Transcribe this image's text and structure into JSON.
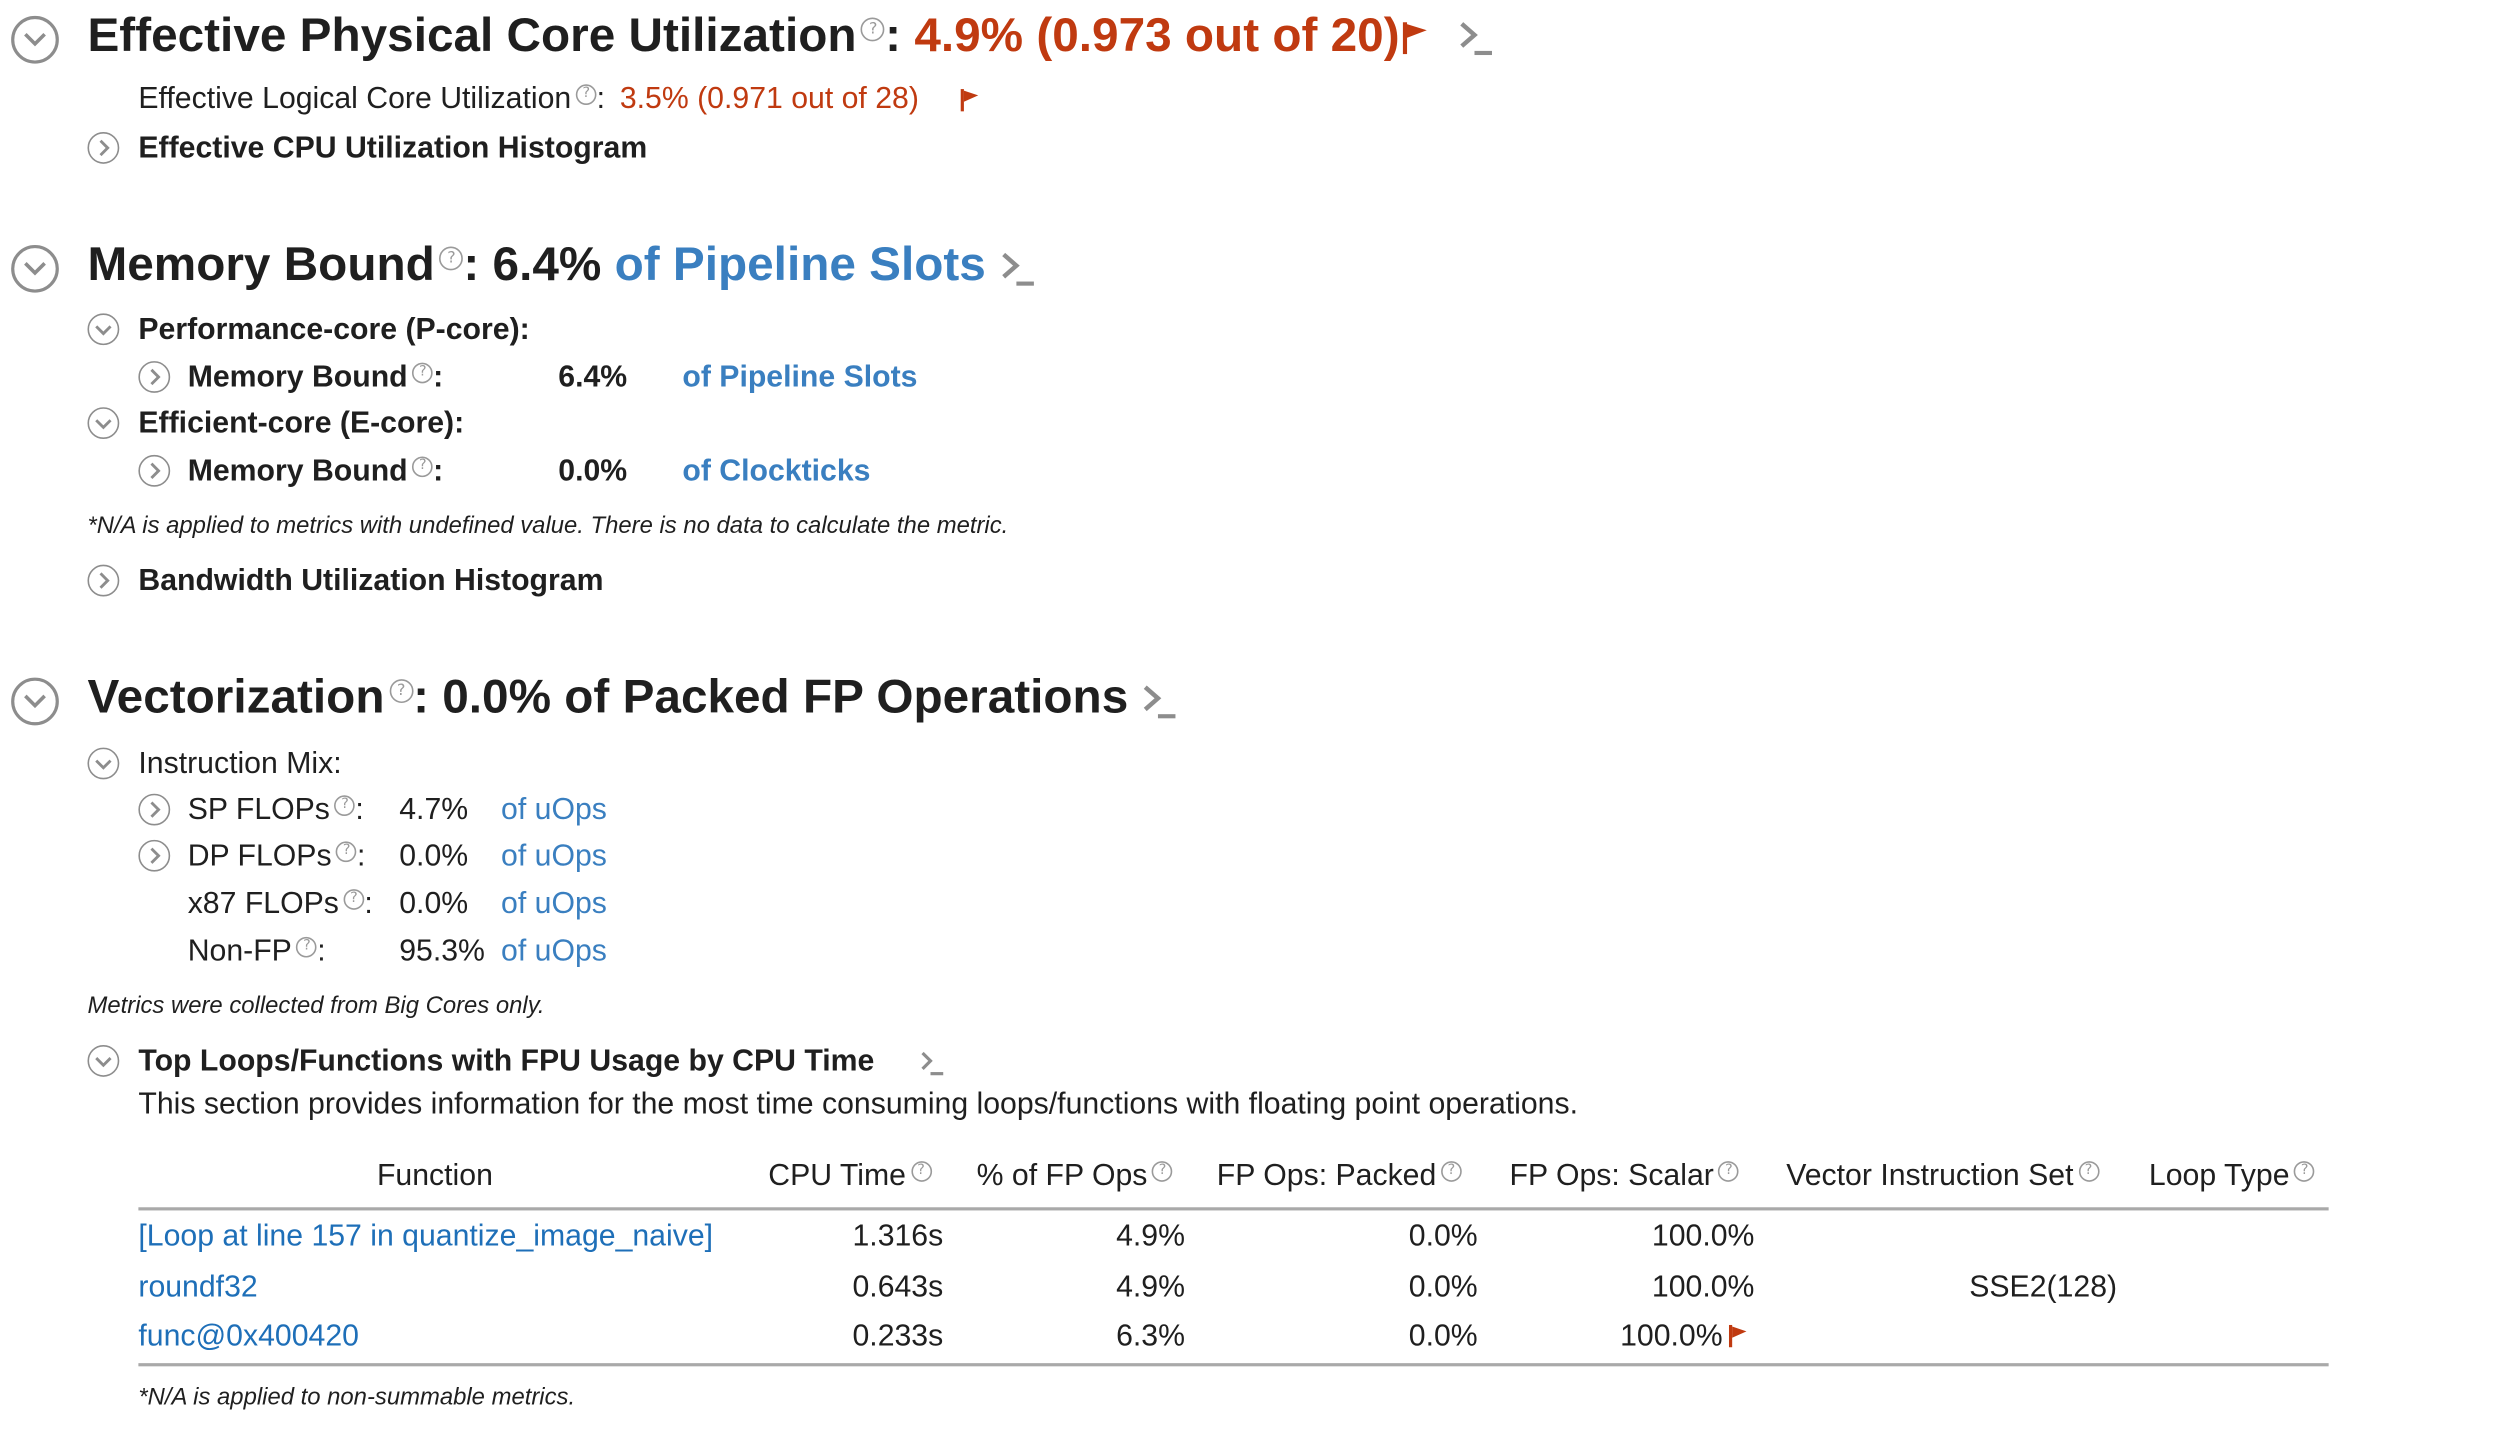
{
  "sections": {
    "physical": {
      "title": "Effective Physical Core Utilization",
      "colon": ":",
      "value": "4.9% (0.973 out of 20)",
      "logical_label": "Effective Logical Core Utilization",
      "logical_value": "3.5% (0.971 out of 28)",
      "histogram": "Effective CPU Utilization Histogram"
    },
    "memory": {
      "title": "Memory Bound",
      "value": ": 6.4%",
      "unit": "of Pipeline Slots",
      "pcore": "Performance-core (P-core):",
      "ecore": "Efficient-core (E-core):",
      "mb_label": "Memory Bound",
      "p_value": "6.4%",
      "p_unit": "of Pipeline Slots",
      "e_value": "0.0%",
      "e_unit": "of Clockticks",
      "na_note": "*N/A is applied to metrics with undefined value. There is no data to calculate the metric.",
      "bandwidth": "Bandwidth Utilization Histogram"
    },
    "vector": {
      "title": "Vectorization",
      "value": ": 0.0% of Packed FP Operations",
      "mix_label": "Instruction Mix:",
      "mix": [
        {
          "label": "SP FLOPs",
          "value": "4.7%",
          "unit": "of uOps"
        },
        {
          "label": "DP FLOPs",
          "value": "0.0%",
          "unit": "of uOps"
        },
        {
          "label": "x87 FLOPs",
          "value": "0.0%",
          "unit": "of uOps"
        },
        {
          "label": "Non-FP",
          "value": "95.3%",
          "unit": "of uOps"
        }
      ],
      "big_cores_note": "Metrics were collected from Big Cores only.",
      "top_title": "Top Loops/Functions with FPU Usage by CPU Time",
      "top_desc": "This section provides information for the most time consuming loops/functions with floating point operations.",
      "table": {
        "headers": [
          "Function",
          "CPU Time",
          "% of FP Ops",
          "FP Ops: Packed",
          "FP Ops: Scalar",
          "Vector Instruction Set",
          "Loop Type"
        ],
        "rows": [
          {
            "func": "[Loop at line 157 in quantize_image_naive]",
            "cpu": "1.316s",
            "fp": "4.9%",
            "packed": "0.0%",
            "scalar": "100.0%",
            "vis": "",
            "loop": ""
          },
          {
            "func": "roundf32",
            "cpu": "0.643s",
            "fp": "4.9%",
            "packed": "0.0%",
            "scalar": "100.0%",
            "vis": "SSE2(128)",
            "loop": ""
          },
          {
            "func": "func@0x400420",
            "cpu": "0.233s",
            "fp": "6.3%",
            "packed": "0.0%",
            "scalar": "100.0%",
            "vis": "",
            "loop": ""
          }
        ]
      },
      "table_note": "*N/A is applied to non-summable metrics."
    }
  },
  "icons": {
    "help": "?",
    "flag_color": "#c03a10",
    "link_color": "#3a7fc0"
  }
}
